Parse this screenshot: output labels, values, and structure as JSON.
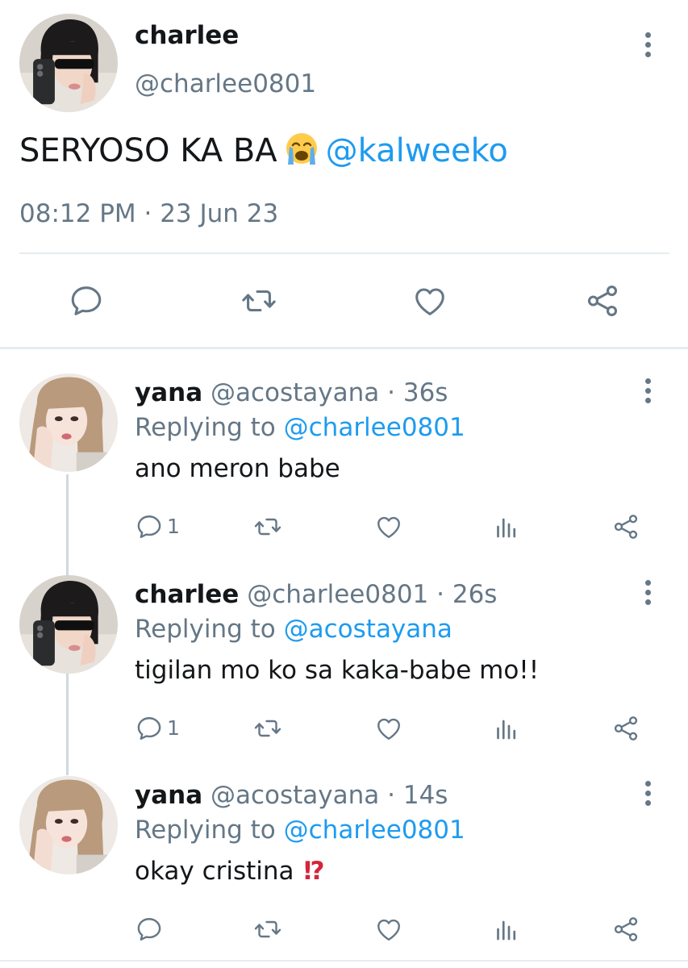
{
  "main_tweet": {
    "name": "charlee",
    "handle": "@charlee0801",
    "text": "SERYOSO KA BA",
    "emoji": "loudly-crying-face",
    "mention": "@kalweeko",
    "timestamp": "08:12 PM · 23 Jun 23",
    "actions": [
      "reply-icon",
      "retweet-icon",
      "like-icon",
      "share-icon"
    ]
  },
  "replies": [
    {
      "name": "yana",
      "handle": "@acostayana",
      "time": " · 36s",
      "replying_prefix": "Replying to ",
      "replying_to": "@charlee0801",
      "text": "ano meron babe",
      "reply_count": "1"
    },
    {
      "name": "charlee",
      "handle": "@charlee0801",
      "time": " · 26s",
      "replying_prefix": "Replying to ",
      "replying_to": "@acostayana",
      "text": "tigilan mo ko sa kaka-babe mo!!",
      "reply_count": "1"
    },
    {
      "name": "yana",
      "handle": "@acostayana",
      "time": " · 14s",
      "replying_prefix": "Replying to ",
      "replying_to": "@charlee0801",
      "text": "okay cristina ",
      "emoji": "!?",
      "reply_count": ""
    }
  ],
  "colors": {
    "accent": "#1d9bf0",
    "muted": "#657786",
    "text": "#14171a",
    "divider": "#e6ecf0"
  }
}
